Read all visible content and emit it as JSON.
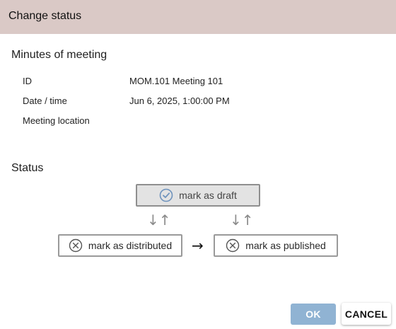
{
  "dialog": {
    "title": "Change status"
  },
  "minutes": {
    "section_title": "Minutes of meeting",
    "fields": [
      {
        "label": "ID",
        "value": "MOM.101 Meeting 101"
      },
      {
        "label": "Date / time",
        "value": "Jun 6, 2025, 1:00:00 PM"
      },
      {
        "label": "Meeting location",
        "value": ""
      }
    ]
  },
  "status": {
    "section_title": "Status",
    "draft": {
      "label": "mark as draft",
      "icon": "check-circle-icon",
      "current": true
    },
    "distributed": {
      "label": "mark as distributed",
      "icon": "x-circle-icon"
    },
    "published": {
      "label": "mark as published",
      "icon": "x-circle-icon"
    },
    "arrows": {
      "updown_left": "↓↑",
      "updown_right": "↓↑",
      "right": "→"
    }
  },
  "footer": {
    "ok_label": "OK",
    "cancel_label": "CANCEL"
  },
  "colors": {
    "titlebar": "#dac9c6",
    "ok_button": "#90b3d3",
    "icon_blue": "#6f93bd"
  }
}
